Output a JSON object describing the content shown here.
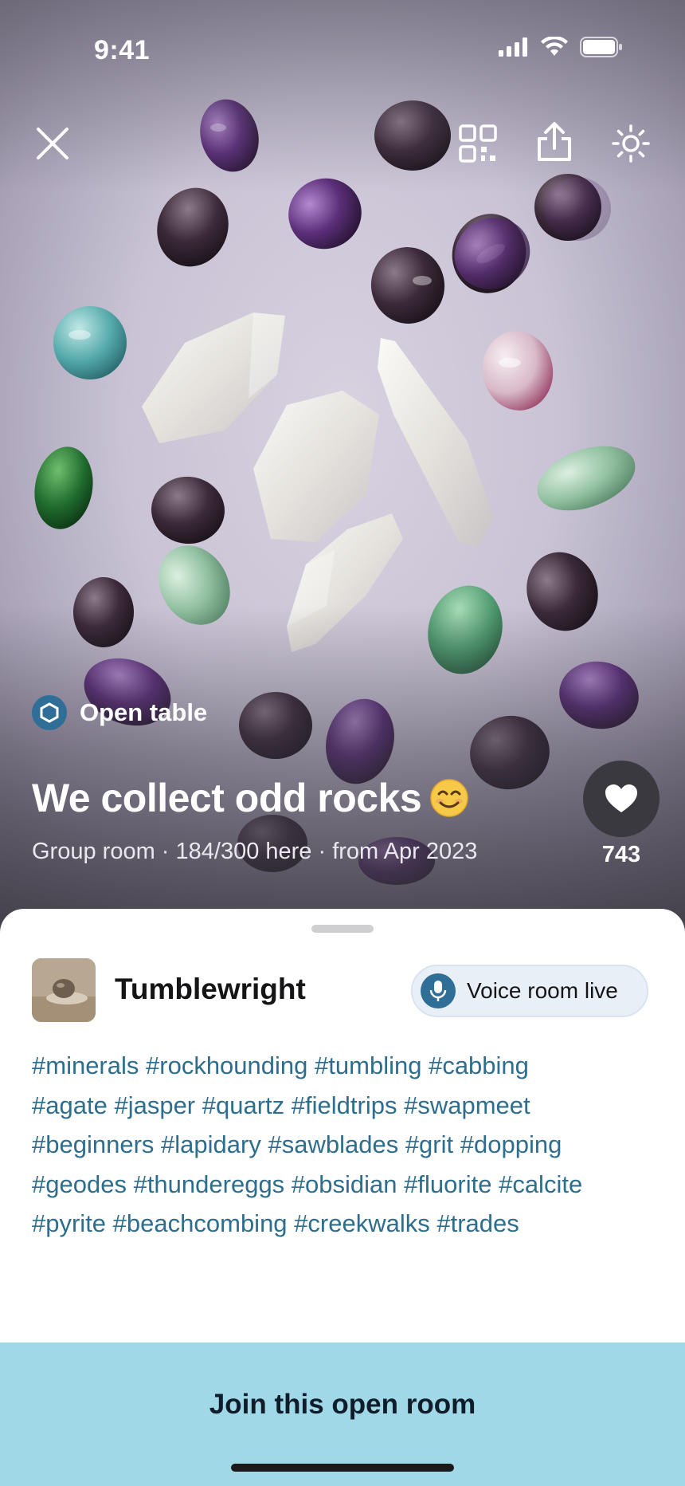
{
  "status_bar": {
    "time": "9:41"
  },
  "hero": {
    "badge_label": "Open table",
    "title": "We collect odd rocks",
    "meta": "Group room · 184/300 here · from Apr 2023",
    "likes": "743"
  },
  "owner": {
    "name": "Tumblewright"
  },
  "voice": {
    "label": "Voice room live"
  },
  "tags": [
    "#minerals",
    "#rockhounding",
    "#tumbling",
    "#cabbing",
    "#agate",
    "#jasper",
    "#quartz",
    "#fieldtrips",
    "#swapmeet",
    "#beginners",
    "#lapidary",
    "#sawblades",
    "#grit",
    "#dopping",
    "#geodes",
    "#thundereggs",
    "#obsidian",
    "#fluorite",
    "#calcite",
    "#pyrite",
    "#beachcombing",
    "#creekwalks",
    "#trades"
  ],
  "join": {
    "label": "Join this open room"
  },
  "icons": {
    "close": "close-icon",
    "qr": "qr-code-icon",
    "share": "share-icon",
    "brightness": "brightness-icon",
    "heart": "heart-icon",
    "mic": "mic-icon",
    "badge": "hexagon-icon"
  },
  "colors": {
    "accent": "#2f6f97",
    "tag": "#2d6d8e",
    "join_bg": "#a1d8e8"
  }
}
